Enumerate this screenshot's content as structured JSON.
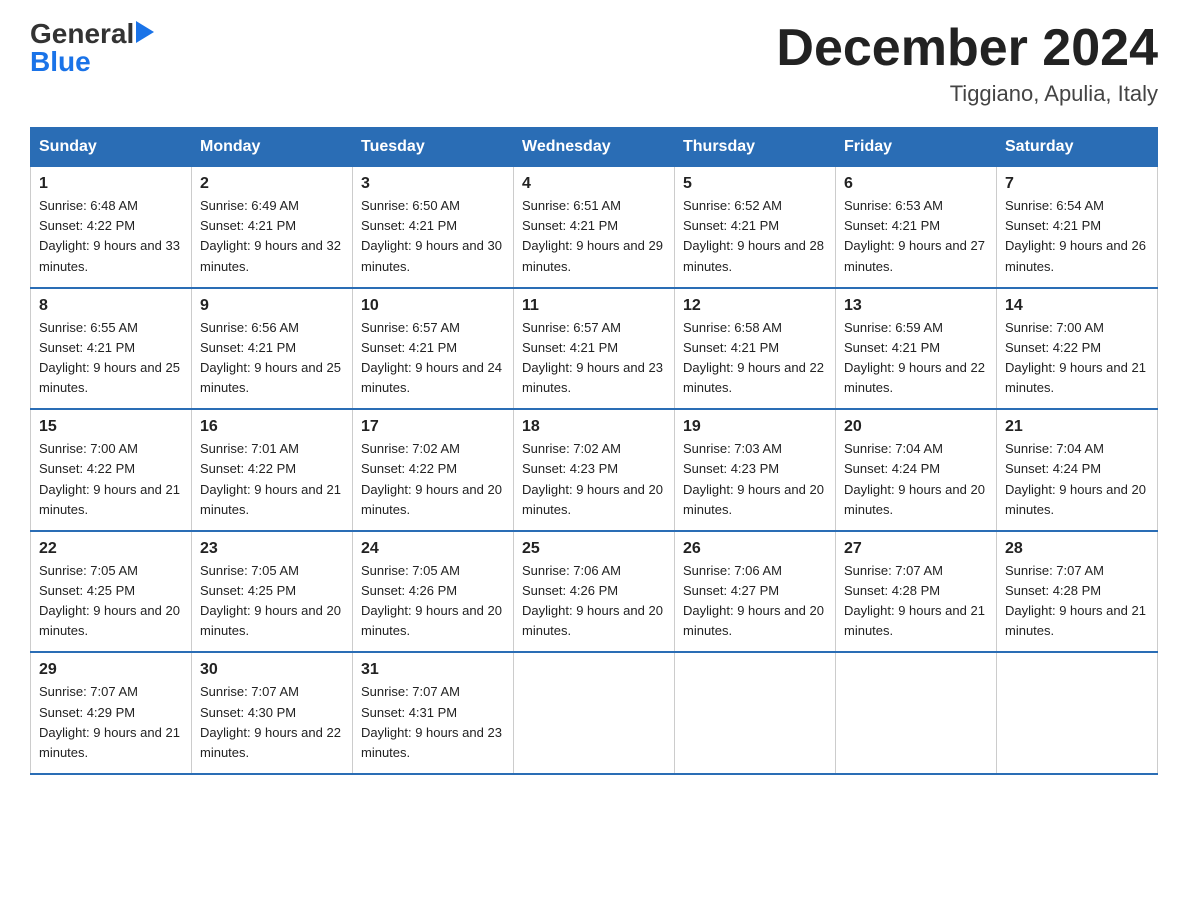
{
  "logo": {
    "general": "General",
    "blue": "Blue",
    "arrow": "▶"
  },
  "title": "December 2024",
  "subtitle": "Tiggiano, Apulia, Italy",
  "days_of_week": [
    "Sunday",
    "Monday",
    "Tuesday",
    "Wednesday",
    "Thursday",
    "Friday",
    "Saturday"
  ],
  "weeks": [
    [
      {
        "day": "1",
        "sunrise": "6:48 AM",
        "sunset": "4:22 PM",
        "daylight": "9 hours and 33 minutes."
      },
      {
        "day": "2",
        "sunrise": "6:49 AM",
        "sunset": "4:21 PM",
        "daylight": "9 hours and 32 minutes."
      },
      {
        "day": "3",
        "sunrise": "6:50 AM",
        "sunset": "4:21 PM",
        "daylight": "9 hours and 30 minutes."
      },
      {
        "day": "4",
        "sunrise": "6:51 AM",
        "sunset": "4:21 PM",
        "daylight": "9 hours and 29 minutes."
      },
      {
        "day": "5",
        "sunrise": "6:52 AM",
        "sunset": "4:21 PM",
        "daylight": "9 hours and 28 minutes."
      },
      {
        "day": "6",
        "sunrise": "6:53 AM",
        "sunset": "4:21 PM",
        "daylight": "9 hours and 27 minutes."
      },
      {
        "day": "7",
        "sunrise": "6:54 AM",
        "sunset": "4:21 PM",
        "daylight": "9 hours and 26 minutes."
      }
    ],
    [
      {
        "day": "8",
        "sunrise": "6:55 AM",
        "sunset": "4:21 PM",
        "daylight": "9 hours and 25 minutes."
      },
      {
        "day": "9",
        "sunrise": "6:56 AM",
        "sunset": "4:21 PM",
        "daylight": "9 hours and 25 minutes."
      },
      {
        "day": "10",
        "sunrise": "6:57 AM",
        "sunset": "4:21 PM",
        "daylight": "9 hours and 24 minutes."
      },
      {
        "day": "11",
        "sunrise": "6:57 AM",
        "sunset": "4:21 PM",
        "daylight": "9 hours and 23 minutes."
      },
      {
        "day": "12",
        "sunrise": "6:58 AM",
        "sunset": "4:21 PM",
        "daylight": "9 hours and 22 minutes."
      },
      {
        "day": "13",
        "sunrise": "6:59 AM",
        "sunset": "4:21 PM",
        "daylight": "9 hours and 22 minutes."
      },
      {
        "day": "14",
        "sunrise": "7:00 AM",
        "sunset": "4:22 PM",
        "daylight": "9 hours and 21 minutes."
      }
    ],
    [
      {
        "day": "15",
        "sunrise": "7:00 AM",
        "sunset": "4:22 PM",
        "daylight": "9 hours and 21 minutes."
      },
      {
        "day": "16",
        "sunrise": "7:01 AM",
        "sunset": "4:22 PM",
        "daylight": "9 hours and 21 minutes."
      },
      {
        "day": "17",
        "sunrise": "7:02 AM",
        "sunset": "4:22 PM",
        "daylight": "9 hours and 20 minutes."
      },
      {
        "day": "18",
        "sunrise": "7:02 AM",
        "sunset": "4:23 PM",
        "daylight": "9 hours and 20 minutes."
      },
      {
        "day": "19",
        "sunrise": "7:03 AM",
        "sunset": "4:23 PM",
        "daylight": "9 hours and 20 minutes."
      },
      {
        "day": "20",
        "sunrise": "7:04 AM",
        "sunset": "4:24 PM",
        "daylight": "9 hours and 20 minutes."
      },
      {
        "day": "21",
        "sunrise": "7:04 AM",
        "sunset": "4:24 PM",
        "daylight": "9 hours and 20 minutes."
      }
    ],
    [
      {
        "day": "22",
        "sunrise": "7:05 AM",
        "sunset": "4:25 PM",
        "daylight": "9 hours and 20 minutes."
      },
      {
        "day": "23",
        "sunrise": "7:05 AM",
        "sunset": "4:25 PM",
        "daylight": "9 hours and 20 minutes."
      },
      {
        "day": "24",
        "sunrise": "7:05 AM",
        "sunset": "4:26 PM",
        "daylight": "9 hours and 20 minutes."
      },
      {
        "day": "25",
        "sunrise": "7:06 AM",
        "sunset": "4:26 PM",
        "daylight": "9 hours and 20 minutes."
      },
      {
        "day": "26",
        "sunrise": "7:06 AM",
        "sunset": "4:27 PM",
        "daylight": "9 hours and 20 minutes."
      },
      {
        "day": "27",
        "sunrise": "7:07 AM",
        "sunset": "4:28 PM",
        "daylight": "9 hours and 21 minutes."
      },
      {
        "day": "28",
        "sunrise": "7:07 AM",
        "sunset": "4:28 PM",
        "daylight": "9 hours and 21 minutes."
      }
    ],
    [
      {
        "day": "29",
        "sunrise": "7:07 AM",
        "sunset": "4:29 PM",
        "daylight": "9 hours and 21 minutes."
      },
      {
        "day": "30",
        "sunrise": "7:07 AM",
        "sunset": "4:30 PM",
        "daylight": "9 hours and 22 minutes."
      },
      {
        "day": "31",
        "sunrise": "7:07 AM",
        "sunset": "4:31 PM",
        "daylight": "9 hours and 23 minutes."
      },
      null,
      null,
      null,
      null
    ]
  ]
}
